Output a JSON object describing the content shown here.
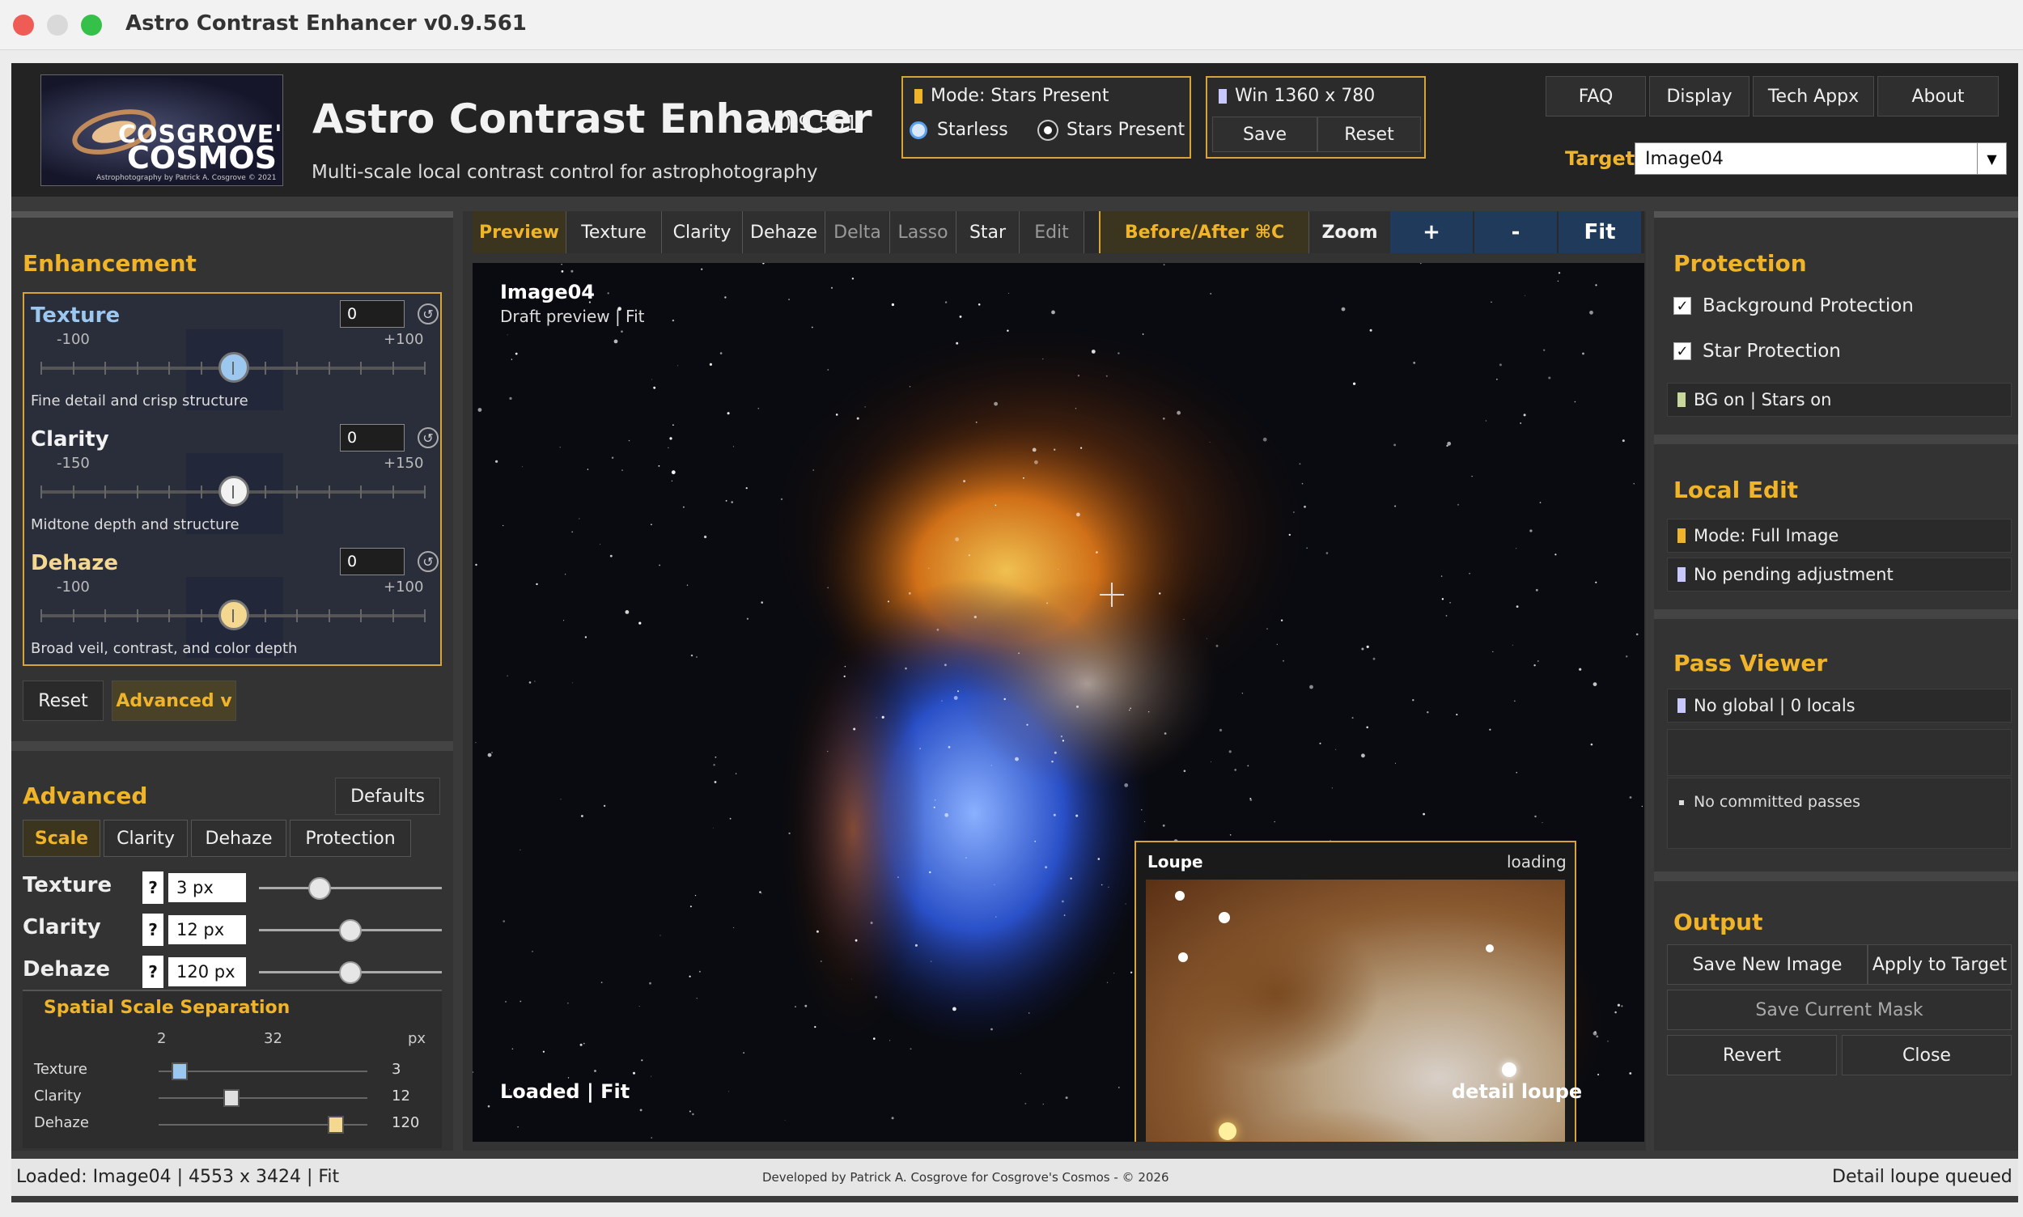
{
  "window": {
    "title": "Astro Contrast Enhancer v0.9.561"
  },
  "header": {
    "logo_text": [
      "COSGROVE'S",
      "COSMOS",
      "Astrophotography by Patrick A. Cosgrove © 2021"
    ],
    "app_title": "Astro Contrast Enhancer",
    "version": "v0.9.561",
    "subtitle": "Multi-scale local contrast control for astrophotography",
    "mode": {
      "label": "Mode: Stars Present",
      "options": [
        "Starless",
        "Stars Present"
      ],
      "selected": "Stars Present"
    },
    "win": {
      "label": "Win 1360 x 780",
      "save": "Save",
      "reset": "Reset"
    },
    "nav": [
      "FAQ",
      "Display",
      "Tech Appx",
      "About"
    ],
    "target": {
      "label": "Target",
      "value": "Image04"
    }
  },
  "enhancement": {
    "heading": "Enhancement",
    "sliders": [
      {
        "name": "Texture",
        "value": "0",
        "min": "-100",
        "max": "+100",
        "desc": "Fine detail and crisp structure",
        "color": "#9cc8f0"
      },
      {
        "name": "Clarity",
        "value": "0",
        "min": "-150",
        "max": "+150",
        "desc": "Midtone depth and structure",
        "color": "#f2f2f2"
      },
      {
        "name": "Dehaze",
        "value": "0",
        "min": "-100",
        "max": "+100",
        "desc": "Broad veil, contrast, and color depth",
        "color": "#f4d890"
      }
    ],
    "reset": "Reset",
    "advanced_toggle": "Advanced v"
  },
  "advanced": {
    "heading": "Advanced",
    "defaults": "Defaults",
    "tabs": [
      "Scale",
      "Clarity",
      "Dehaze",
      "Protection"
    ],
    "rows": [
      {
        "name": "Texture",
        "help": "?",
        "value": "3 px",
        "level": 0.33
      },
      {
        "name": "Clarity",
        "help": "?",
        "value": "12 px",
        "level": 0.5
      },
      {
        "name": "Dehaze",
        "help": "?",
        "value": "120 px",
        "level": 0.5
      }
    ],
    "sss": {
      "heading": "Spatial Scale Separation",
      "scale_labels": [
        "2",
        "32",
        "px"
      ],
      "rows": [
        {
          "name": "Texture",
          "value": "3"
        },
        {
          "name": "Clarity",
          "value": "12"
        },
        {
          "name": "Dehaze",
          "value": "120"
        }
      ]
    }
  },
  "toolbar": {
    "tabs": [
      "Preview",
      "Texture",
      "Clarity",
      "Dehaze",
      "Delta",
      "Lasso",
      "Star",
      "Edit"
    ],
    "before_after": "Before/After ⌘C",
    "zoom_label": "Zoom",
    "zoom_buttons": [
      "+",
      "-",
      "Fit"
    ]
  },
  "preview": {
    "image_name": "Image04",
    "image_sub": "Draft preview | Fit",
    "status_left": "Loaded | Fit",
    "status_right": "detail loupe",
    "loupe": {
      "title": "Loupe",
      "status": "loading"
    }
  },
  "protection": {
    "heading": "Protection",
    "background": "Background Protection",
    "star": "Star Protection",
    "status": "BG on | Stars on"
  },
  "local_edit": {
    "heading": "Local Edit",
    "mode": "Mode: Full Image",
    "pending": "No pending adjustment"
  },
  "pass_viewer": {
    "heading": "Pass Viewer",
    "summary": "No global | 0 locals",
    "empty": "No committed passes"
  },
  "output": {
    "heading": "Output",
    "save_new": "Save New Image",
    "apply": "Apply to Target",
    "save_mask": "Save Current Mask",
    "revert": "Revert",
    "close": "Close"
  },
  "statusbar": {
    "left": "Loaded: Image04 | 4553 x 3424 | Fit",
    "center": "Developed by Patrick A. Cosgrove for Cosgrove's Cosmos - © 2026",
    "right": "Detail loupe queued"
  }
}
